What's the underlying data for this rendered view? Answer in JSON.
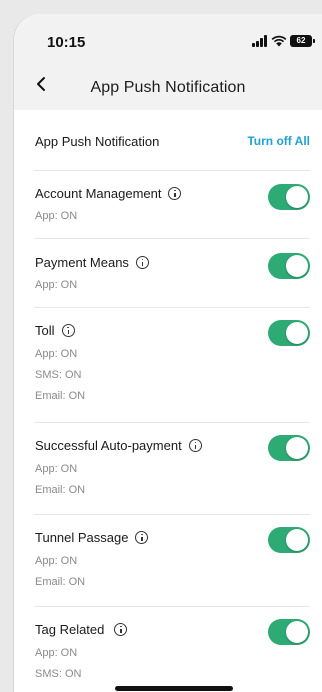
{
  "status_bar": {
    "time": "10:15",
    "battery": "62"
  },
  "nav": {
    "title": "App Push Notification"
  },
  "header": {
    "label": "App Push Notification",
    "action": "Turn off All"
  },
  "items": [
    {
      "title": "Account Management",
      "lines": [
        "App: ON"
      ],
      "enabled": true
    },
    {
      "title": "Payment Means",
      "lines": [
        "App: ON"
      ],
      "enabled": true
    },
    {
      "title": "Toll",
      "lines": [
        "App: ON",
        "SMS: ON",
        "Email: ON"
      ],
      "enabled": true
    },
    {
      "title": "Successful Auto-payment",
      "lines": [
        "App: ON",
        "Email: ON"
      ],
      "enabled": true
    },
    {
      "title": "Tunnel Passage",
      "lines": [
        "App: ON",
        "Email: ON"
      ],
      "enabled": true
    },
    {
      "title": "Tag Related",
      "lines": [
        "App: ON",
        "SMS: ON"
      ],
      "enabled": true
    }
  ],
  "colors": {
    "toggle_on": "#2eaa75",
    "link": "#21a1d6"
  },
  "icons": {
    "back": "chevron-left-icon",
    "info": "info-icon",
    "signal": "signal-icon",
    "wifi": "wifi-icon",
    "battery": "battery-icon"
  }
}
